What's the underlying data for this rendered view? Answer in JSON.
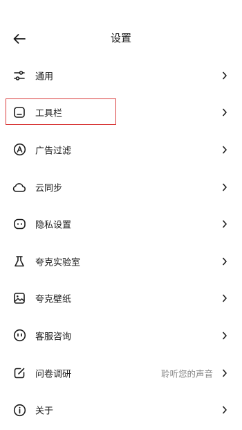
{
  "header": {
    "title": "设置",
    "back_icon": "arrow-left-icon"
  },
  "menu": [
    {
      "id": "general",
      "label": "通用",
      "icon": "sliders-icon",
      "value": ""
    },
    {
      "id": "toolbar",
      "label": "工具栏",
      "icon": "toolbar-icon",
      "value": "",
      "highlighted": true,
      "highlight_color": "#d93a3a"
    },
    {
      "id": "ad-filter",
      "label": "广告过滤",
      "icon": "ad-block-icon",
      "value": ""
    },
    {
      "id": "cloud-sync",
      "label": "云同步",
      "icon": "cloud-icon",
      "value": ""
    },
    {
      "id": "privacy",
      "label": "隐私设置",
      "icon": "privacy-icon",
      "value": ""
    },
    {
      "id": "lab",
      "label": "夸克实验室",
      "icon": "flask-icon",
      "value": ""
    },
    {
      "id": "wallpaper",
      "label": "夸克壁纸",
      "icon": "wallpaper-icon",
      "value": ""
    },
    {
      "id": "support",
      "label": "客服咨询",
      "icon": "support-icon",
      "value": ""
    },
    {
      "id": "survey",
      "label": "问卷调研",
      "icon": "edit-icon",
      "value": "聆听您的声音"
    },
    {
      "id": "about",
      "label": "关于",
      "icon": "info-icon",
      "value": ""
    }
  ]
}
